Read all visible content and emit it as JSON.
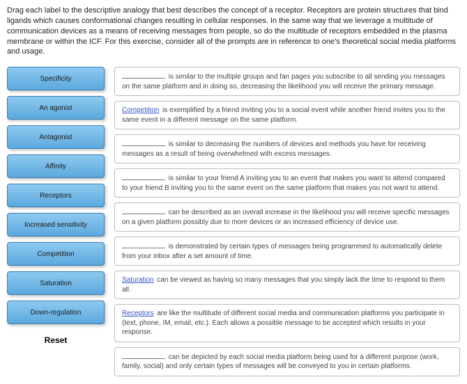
{
  "instructions": "Drag each label to the descriptive analogy that best describes the concept of a receptor.  Receptors are protein structures that bind ligands which causes conformational changes resulting in cellular responses.  In the same way that we leverage a multitude of communication devices as a means of receiving messages from people, so do the multitude of receptors embedded in the plasma membrane or within the ICF.  For this exercise, consider all of the prompts are in reference to one's theoretical social media platforms and usage.",
  "labels": [
    "Specificity",
    "An agonist",
    "Antagonist",
    "Affinity",
    "Receptors",
    "Increased sensitivity",
    "Competition",
    "Saturation",
    "Down-regulation"
  ],
  "reset": "Reset",
  "targets": [
    {
      "filled": "",
      "text": " is similar to the multiple groups and fan pages you subscribe to all sending you messages on the same platform and in doing so, decreasing the likelihood you will receive the primary message."
    },
    {
      "filled": "Competition",
      "text": " is exemplified by a friend inviting you to a social event while another friend invites you to the same event in a different message on the same platform."
    },
    {
      "filled": "",
      "text": " is similar to decreasing the numbers of devices and methods you have for receiving messages as a result of being overwhelmed with excess messages."
    },
    {
      "filled": "",
      "text": " is similar to your friend A inviting you to an event that makes you want to attend compared to your friend B inviting you to the same event on the same platform that makes you not want to attend."
    },
    {
      "filled": "",
      "text": " can be described as an overall increase in the likelihood you will receive specific messages on a given platform possibly due to more devices or an increased efficiency of device use."
    },
    {
      "filled": "",
      "text": " is demonstrated by certain types of messages being programmed to automatically delete from your inbox after a set amount of time."
    },
    {
      "filled": "Saturation",
      "text": " can be viewed as having so many messages that you simply lack the time to respond to them all."
    },
    {
      "filled": "Receptors",
      "text": " are like the multitude of different social media and communication platforms you participate in (text, phone, IM, email, etc.).  Each allows a possible message to be accepted which results in your response."
    },
    {
      "filled": "",
      "text": " can be depicted by each social media platform being used for a different purpose (work, family, social) and only certain types of messages will be conveyed to you in certain platforms."
    }
  ]
}
